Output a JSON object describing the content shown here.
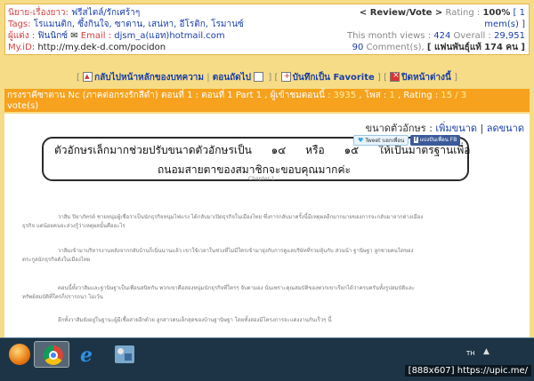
{
  "info": {
    "category_label": "นิยาย-เรื่องยาว:",
    "category_value": "ฟรีสไตล์/รักเศร้าๆ",
    "tags_label": "Tags:",
    "tags_value": "โรแมนติก, ซึ้งกินใจ, ซาตาน, เสน่หา, อีโรติก, โรมานซ์",
    "author_label": "ผู้แต่ง :",
    "author_value": "ฟินนิกซ์",
    "email_label": "Email :",
    "email_value": "djsm_a(แอท)hotmail.com",
    "myid_label": "My.iD:",
    "myid_value": "http://my.dek-d.com/pocidon",
    "review_vote": "< Review/Vote >",
    "rating_label": "Rating :",
    "rating_value": "100%",
    "rating_suffix_a": "[ 1",
    "rating_suffix_b": "mem(s) ]",
    "month_views_label": "This month views :",
    "month_views_value": "424",
    "overall_label": "Overall :",
    "overall_value": "29,951",
    "comments_value": "90",
    "comments_label": "Comment(s),",
    "fans_label": "[ แฟนพันธุ์แท้",
    "fans_value": "174 คน ]"
  },
  "nav": {
    "back_home": "กลับไปหน้าหลักของบทความ",
    "prev_chapter": "ตอนถัดไป",
    "save_favorite": "บันทึกเป็น Favorite",
    "close_page": "ปิดหน้าต่างนี้"
  },
  "chapter_bar": {
    "title": "กรงราคีซาตาน Nc (ภาคต่อกรงรักสีดำ) ตอนที่ 1 : ตอนที่ 1 Part 1 , ผู้เข้าชมตอนนี้ :",
    "views": "3935",
    "posts_label": ", โพส :",
    "posts": "1",
    "rating_label": ", Rating :",
    "rating": "15 / 3",
    "votes": "vote(s)"
  },
  "content": {
    "fontsize_label": "ขนาดตัวอักษร :",
    "increase": "เพิ่มขนาด",
    "decrease": "ลดขนาด",
    "tweet_button": "Tweet บอกเพื่อน",
    "fb_button": "แบ่งปันเพื่อน FB",
    "notice_line1_a": "ตัวอักษรเล็กมากช่วยปรับขนาดตัวอักษรเป็น",
    "notice_num1": "๑๔",
    "notice_or": "หรือ",
    "notice_num2": "๑๕",
    "notice_line1_b": "ให้เป็นมาตรฐานเพื่อ",
    "notice_line2": "ถนอมสายตาของสมาชิกจะขอบคุณมากค่ะ",
    "chapter_tag": "Chapter 1",
    "para1": "วาสิม ปิยาภัทรต์ ชายหนุ่มผู้เชื่อว่าเป็นนักธุรกิจหนุ่มไฟแรง ได้กลับมาเปิดธุรกิจในเมืองไทย ซึ่งการกลับมาครั้งนี้มีเหตุผลอีกมากมายของการจะกลับมาจากต่างเมือง",
    "para1b": "ธุรกิจ แต่น้อยคนจะล่วงรู้ว่าเหตุผลนั้นคืออะไร",
    "para2": "วาสิมเข้ามาบริหารงานหลังจากกลับบ้านก็เนิ่นนานแล้ว เขาใช้เวลาในช่วงที่ไม่มีใครเข้ามายุ่งกับการดูแลบริษัทที่รวมหุ้นกับ ส่วนน้า ฐานิษฐา ลูกชายคนโตของ",
    "para2b": "ตระกูลนักธุรกิจดังในเมืองไทย",
    "para3": "ตอนนี้ทั้งวาสิมและฐานิษฐาเป็นเพื่อนสนิทกัน พวกเขาคือสองหนุ่มนักธุรกิจที่ใครๆ จับตามอง นั่นเพราะคุณสมบัติของพวกเขาเรียกได้ว่าครบครันทั้งรูปสมบัติและ",
    "para3b": "ทรัพย์สมบัติที่ใครก็ปรารถนา ไม่เว้น",
    "para4": "อีกทั้งวาสิมยังอยู่ในฐานะผู้มีเชื้อสายอีกด้วย ลูกสาวคนเล็กสุดของบ้านฐานิษฐา โดยทั้งสองมีโครงการจะแต่งงานกันเร็วๆ นี้"
  },
  "taskbar": {
    "lang": "TH",
    "watermark": "[888x607] https://upic.me/"
  }
}
